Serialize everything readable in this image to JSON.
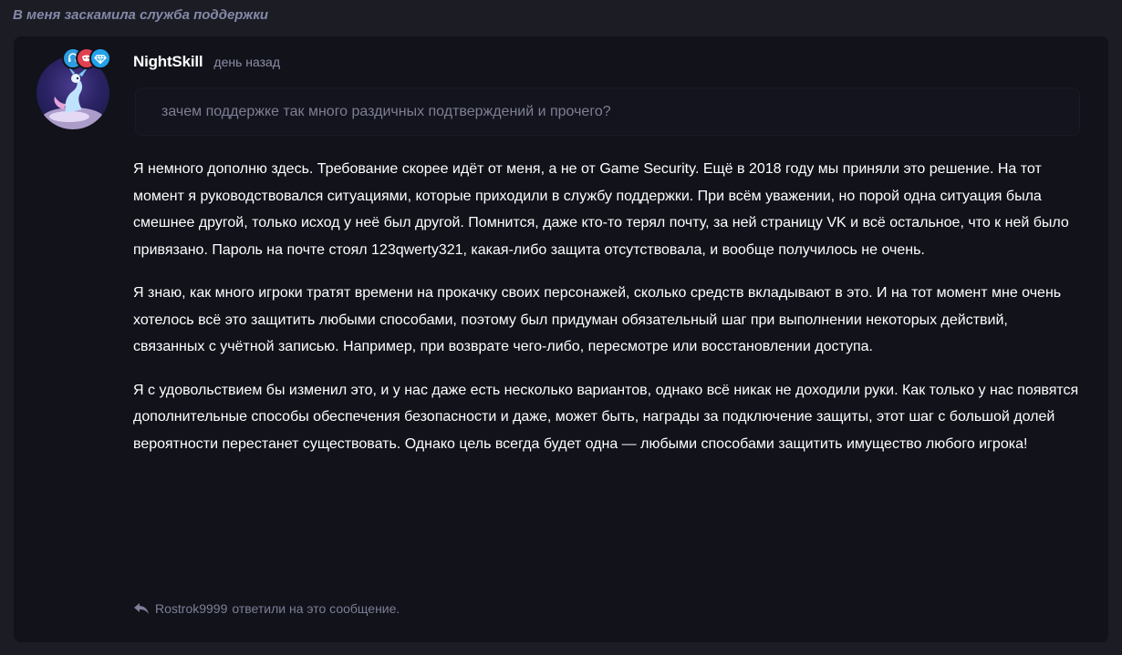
{
  "thread": {
    "title": "В меня заскамила служба поддержки"
  },
  "post": {
    "username": "NightSkill",
    "time": "день назад",
    "quote": "зачем поддержке так много раздичных подтверждений и прочего?",
    "paragraphs": [
      "Я немного дополню здесь. Требование скорее идёт от меня, а не от Game Security. Ещё в 2018 году мы приняли это решение. На тот момент я руководствовался ситуациями, которые приходили в службу поддержки. При всём уважении, но порой одна ситуация была смешнее другой, только исход у неё был другой. Помнится, даже кто-то терял почту, за ней страницу VK и всё остальное, что к ней было привязано. Пароль на почте стоял 123qwerty321, какая-либо защита отсутствовала, и вообще получилось не очень.",
      "Я знаю, как много игроки тратят времени на прокачку своих персонажей, сколько средств вкладывают в это. И на тот момент мне очень хотелось всё это защитить любыми способами, поэтому был придуман обязательный шаг при выполнении некоторых действий, связанных с учётной записью. Например, при возврате чего-либо, пересмотре или восстановлении доступа.",
      "Я с удовольствием бы изменил это, и у нас даже есть несколько вариантов, однако всё никак не доходили руки. Как только у нас появятся дополнительные способы обеспечения безопасности и даже, может быть, награды за подключение защиты, этот шаг с большой долей вероятности перестанет существовать. Однако цель всегда будет одна — любыми способами защитить имущество любого игрока!"
    ],
    "reply": {
      "user": "Rostrok9999",
      "text": "ответили на это сообщение."
    }
  },
  "badges": [
    {
      "icon": "headset-icon",
      "color": "#2d9de0"
    },
    {
      "icon": "mask-icon",
      "color": "#e04050"
    },
    {
      "icon": "diamond-icon",
      "color": "#22a3ea"
    }
  ]
}
